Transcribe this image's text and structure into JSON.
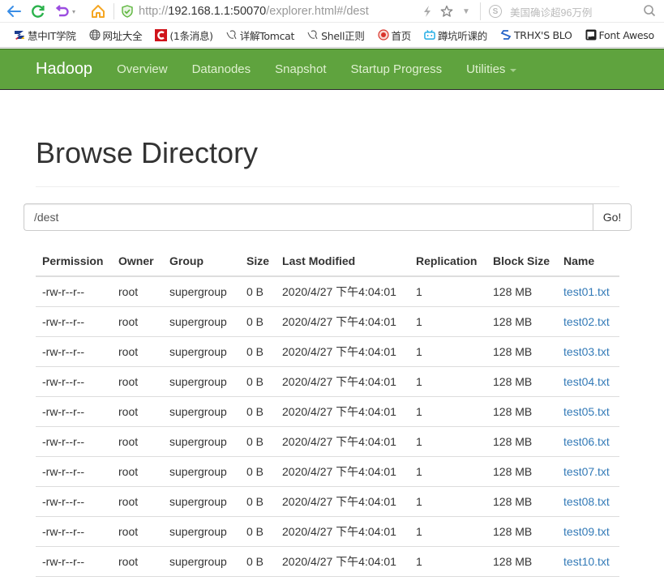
{
  "browser": {
    "url_prefix": "http://",
    "url_host": "192.168.1.1:50070",
    "url_path": "/explorer.html#/dest",
    "search_placeholder": "美国确诊超96万例",
    "icons": {
      "back": "arrow-left-icon",
      "refresh": "refresh-icon",
      "undo": "undo-icon",
      "home": "home-icon",
      "secure": "shield-check-icon",
      "lightning": "lightning-icon",
      "star": "star-icon",
      "dropdown": "chevron-down-icon",
      "search_engine": "sogou-icon",
      "search": "search-icon"
    }
  },
  "bookmarks": [
    {
      "label": "慧中IT学院",
      "icon": "huizhong-logo-icon"
    },
    {
      "label": "网址大全",
      "icon": "globe-icon"
    },
    {
      "label": "(1条消息)",
      "icon": "csdn-icon"
    },
    {
      "label": "详解Tomcat",
      "icon": "page-icon"
    },
    {
      "label": "Shell正则",
      "icon": "page-icon"
    },
    {
      "label": "首页",
      "icon": "badge-icon"
    },
    {
      "label": "蹲坑听课的",
      "icon": "bilibili-icon"
    },
    {
      "label": "TRHX'S BLO",
      "icon": "trhx-icon"
    },
    {
      "label": "Font Aweso",
      "icon": "flag-icon"
    }
  ],
  "navbar": {
    "brand": "Hadoop",
    "items": [
      {
        "label": "Overview"
      },
      {
        "label": "Datanodes"
      },
      {
        "label": "Snapshot"
      },
      {
        "label": "Startup Progress"
      },
      {
        "label": "Utilities",
        "dropdown": true
      }
    ],
    "color": "#5fa33e"
  },
  "page": {
    "title": "Browse Directory",
    "path_value": "/dest",
    "go_label": "Go!"
  },
  "table": {
    "headers": [
      "Permission",
      "Owner",
      "Group",
      "Size",
      "Last Modified",
      "Replication",
      "Block Size",
      "Name"
    ],
    "rows": [
      {
        "permission": "-rw-r--r--",
        "owner": "root",
        "group": "supergroup",
        "size": "0 B",
        "modified": "2020/4/27 下午4:04:01",
        "replication": "1",
        "block_size": "128 MB",
        "name": "test01.txt"
      },
      {
        "permission": "-rw-r--r--",
        "owner": "root",
        "group": "supergroup",
        "size": "0 B",
        "modified": "2020/4/27 下午4:04:01",
        "replication": "1",
        "block_size": "128 MB",
        "name": "test02.txt"
      },
      {
        "permission": "-rw-r--r--",
        "owner": "root",
        "group": "supergroup",
        "size": "0 B",
        "modified": "2020/4/27 下午4:04:01",
        "replication": "1",
        "block_size": "128 MB",
        "name": "test03.txt"
      },
      {
        "permission": "-rw-r--r--",
        "owner": "root",
        "group": "supergroup",
        "size": "0 B",
        "modified": "2020/4/27 下午4:04:01",
        "replication": "1",
        "block_size": "128 MB",
        "name": "test04.txt"
      },
      {
        "permission": "-rw-r--r--",
        "owner": "root",
        "group": "supergroup",
        "size": "0 B",
        "modified": "2020/4/27 下午4:04:01",
        "replication": "1",
        "block_size": "128 MB",
        "name": "test05.txt"
      },
      {
        "permission": "-rw-r--r--",
        "owner": "root",
        "group": "supergroup",
        "size": "0 B",
        "modified": "2020/4/27 下午4:04:01",
        "replication": "1",
        "block_size": "128 MB",
        "name": "test06.txt"
      },
      {
        "permission": "-rw-r--r--",
        "owner": "root",
        "group": "supergroup",
        "size": "0 B",
        "modified": "2020/4/27 下午4:04:01",
        "replication": "1",
        "block_size": "128 MB",
        "name": "test07.txt"
      },
      {
        "permission": "-rw-r--r--",
        "owner": "root",
        "group": "supergroup",
        "size": "0 B",
        "modified": "2020/4/27 下午4:04:01",
        "replication": "1",
        "block_size": "128 MB",
        "name": "test08.txt"
      },
      {
        "permission": "-rw-r--r--",
        "owner": "root",
        "group": "supergroup",
        "size": "0 B",
        "modified": "2020/4/27 下午4:04:01",
        "replication": "1",
        "block_size": "128 MB",
        "name": "test09.txt"
      },
      {
        "permission": "-rw-r--r--",
        "owner": "root",
        "group": "supergroup",
        "size": "0 B",
        "modified": "2020/4/27 下午4:04:01",
        "replication": "1",
        "block_size": "128 MB",
        "name": "test10.txt"
      }
    ]
  }
}
